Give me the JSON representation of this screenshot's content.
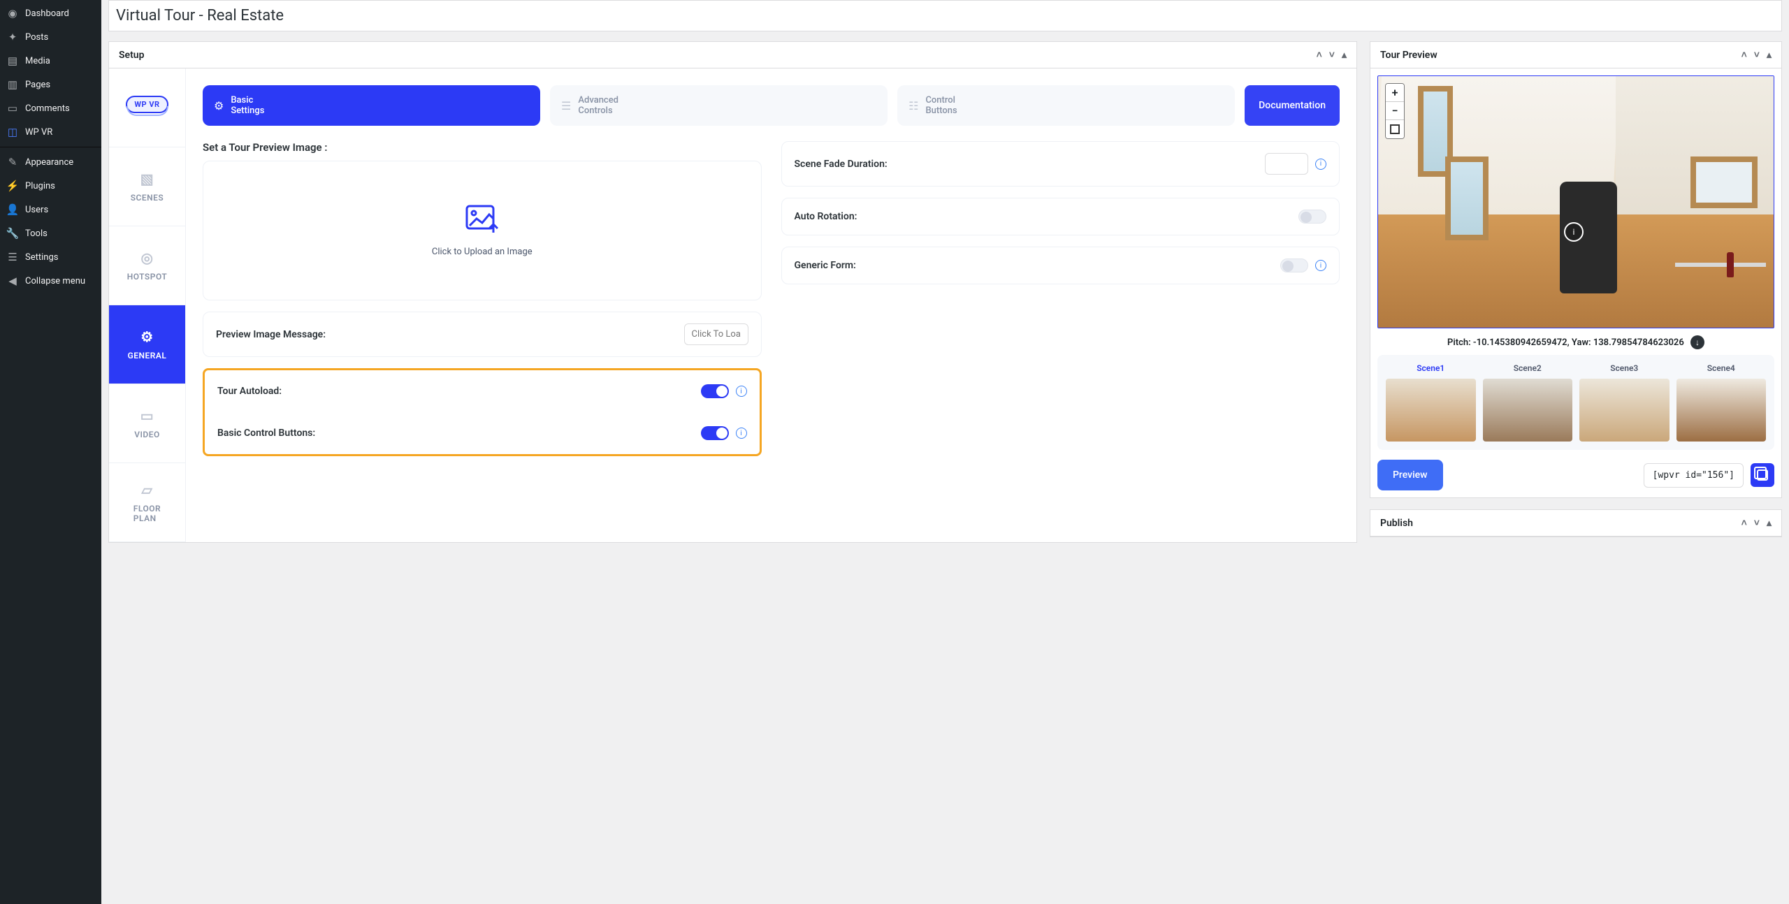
{
  "sidebar": {
    "items": [
      {
        "label": "Dashboard",
        "icon": "⚙"
      },
      {
        "label": "Posts",
        "icon": "📌"
      },
      {
        "label": "Media",
        "icon": "🖼"
      },
      {
        "label": "Pages",
        "icon": "❐"
      },
      {
        "label": "Comments",
        "icon": "💬"
      },
      {
        "label": "WP VR",
        "icon": "⬚"
      }
    ],
    "group2": [
      {
        "label": "Appearance",
        "icon": "🖌"
      },
      {
        "label": "Plugins",
        "icon": "🔌"
      },
      {
        "label": "Users",
        "icon": "👤"
      },
      {
        "label": "Tools",
        "icon": "🔧"
      },
      {
        "label": "Settings",
        "icon": "☰"
      },
      {
        "label": "Collapse menu",
        "icon": "◀"
      }
    ]
  },
  "title": "Virtual Tour - Real Estate",
  "panels": {
    "setup_title": "Setup",
    "preview_title": "Tour Preview",
    "publish_title": "Publish"
  },
  "side_tabs": {
    "logo": "WP VR",
    "scenes": "SCENES",
    "hotspot": "HOTSPOT",
    "general": "GENERAL",
    "video": "VIDEO",
    "floorplan_1": "FLOOR",
    "floorplan_2": "PLAN"
  },
  "top_tabs": {
    "basic_1": "Basic",
    "basic_2": "Settings",
    "adv_1": "Advanced",
    "adv_2": "Controls",
    "ctrl_1": "Control",
    "ctrl_2": "Buttons",
    "doc": "Documentation"
  },
  "form": {
    "preview_image_heading": "Set a Tour Preview Image :",
    "upload_text": "Click to Upload an Image",
    "preview_msg_label": "Preview Image Message:",
    "preview_msg_placeholder": "Click To Load",
    "autoload_label": "Tour Autoload:",
    "basic_ctrl_label": "Basic Control Buttons:",
    "fade_label": "Scene Fade Duration:",
    "auto_rot_label": "Auto Rotation:",
    "generic_form_label": "Generic Form:"
  },
  "tour": {
    "pitch_label": "Pitch:",
    "pitch_value": "-10.145380942659472,",
    "yaw_label": "Yaw:",
    "yaw_value": "138.79854784623026",
    "scenes": [
      "Scene1",
      "Scene2",
      "Scene3",
      "Scene4"
    ],
    "preview_btn": "Preview",
    "shortcode": "[wpvr id=\"156\"]"
  }
}
